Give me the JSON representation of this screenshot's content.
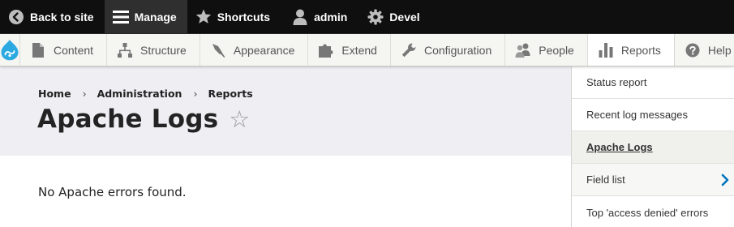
{
  "toolbar": {
    "back_label": "Back to site",
    "manage_label": "Manage",
    "shortcuts_label": "Shortcuts",
    "user_label": "admin",
    "devel_label": "Devel"
  },
  "tray": {
    "items": [
      {
        "label": "Content",
        "icon": "document-icon"
      },
      {
        "label": "Structure",
        "icon": "sitemap-icon"
      },
      {
        "label": "Appearance",
        "icon": "paintbrush-icon"
      },
      {
        "label": "Extend",
        "icon": "puzzle-icon"
      },
      {
        "label": "Configuration",
        "icon": "wrench-icon"
      },
      {
        "label": "People",
        "icon": "people-icon"
      },
      {
        "label": "Reports",
        "icon": "bar-chart-icon"
      },
      {
        "label": "Help",
        "icon": "help-icon"
      }
    ]
  },
  "breadcrumb": {
    "items": [
      "Home",
      "Administration",
      "Reports"
    ],
    "separator": "›"
  },
  "page": {
    "title": "Apache Logs",
    "star": "☆",
    "message": "No Apache errors found."
  },
  "reports_menu": {
    "items": [
      {
        "label": "Status report"
      },
      {
        "label": "Recent log messages"
      },
      {
        "label": "Apache Logs"
      },
      {
        "label": "Field list"
      },
      {
        "label": "Top 'access denied' errors"
      }
    ]
  },
  "colors": {
    "toolbar_bg": "#0f0f0f",
    "tray_bg": "#f5f5f2",
    "header_bg": "#eeeef3",
    "drupal_blue": "#2ba9e0",
    "chevron_blue": "#0074bd"
  }
}
